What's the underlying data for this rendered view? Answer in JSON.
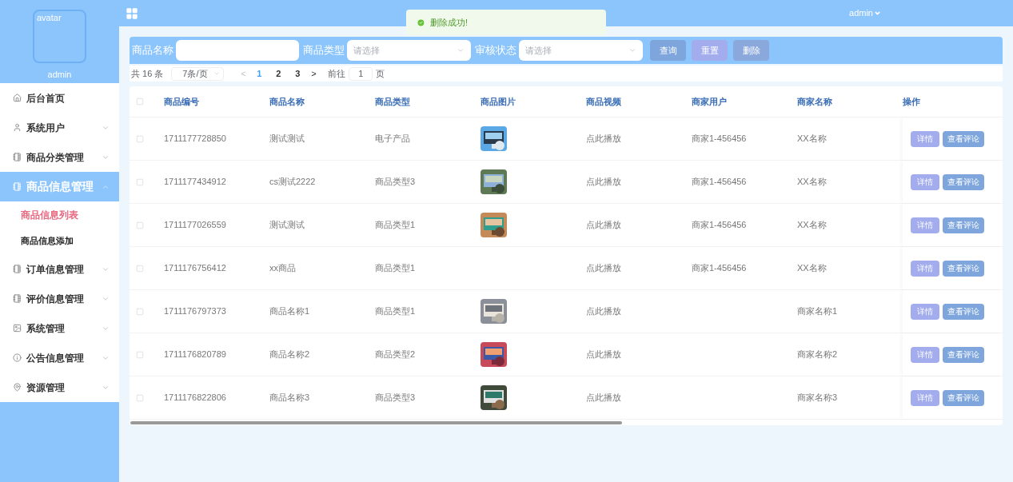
{
  "sidebar": {
    "avatar_alt": "avatar",
    "username": "admin",
    "items": [
      {
        "label": "后台首页",
        "kind": "link",
        "selected": false
      },
      {
        "label": "系统用户",
        "kind": "group",
        "expanded": false,
        "selected": false
      },
      {
        "label": "商品分类管理",
        "kind": "group",
        "expanded": false,
        "selected": false
      },
      {
        "label": "商品信息管理",
        "kind": "group",
        "expanded": true,
        "selected": true,
        "children": [
          {
            "label": "商品信息列表",
            "selected": true
          },
          {
            "label": "商品信息添加",
            "selected": false
          }
        ]
      },
      {
        "label": "订单信息管理",
        "kind": "group",
        "expanded": false,
        "selected": false
      },
      {
        "label": "评价信息管理",
        "kind": "group",
        "expanded": false,
        "selected": false
      },
      {
        "label": "系统管理",
        "kind": "group",
        "expanded": false,
        "selected": false
      },
      {
        "label": "公告信息管理",
        "kind": "group",
        "expanded": false,
        "selected": false
      },
      {
        "label": "资源管理",
        "kind": "group",
        "expanded": false,
        "selected": false
      }
    ]
  },
  "header": {
    "user_menu": "admin"
  },
  "toast": {
    "message": "删除成功!"
  },
  "search": {
    "fields": [
      {
        "label": "商品名称",
        "kind": "input"
      },
      {
        "label": "商品类型",
        "kind": "select",
        "placeholder": "请选择"
      },
      {
        "label": "审核状态",
        "kind": "select",
        "placeholder": "请选择"
      }
    ],
    "buttons": [
      "查询",
      "重置",
      "删除"
    ]
  },
  "pagination": {
    "total": "共 16 条",
    "page_size": "7条/页",
    "prev": "<",
    "pages": [
      {
        "label": "1",
        "selected": true
      },
      {
        "label": "2",
        "selected": false
      },
      {
        "label": "3",
        "selected": false
      }
    ],
    "next": ">",
    "goto_label": "前往",
    "goto_value": "1",
    "goto_suffix": "页"
  },
  "table": {
    "select_all_checked": false,
    "columns": [
      "商品编号",
      "商品名称",
      "商品类型",
      "商品图片",
      "商品视频",
      "商家用户",
      "商家名称",
      "操作"
    ],
    "rows": [
      {
        "checked": false,
        "id": "1711177728850",
        "name": "测试测试",
        "type": "电子产品",
        "image": {
          "kind": "picture"
        },
        "video": "点此播放",
        "merchant_user": "商家1-456456",
        "merchant_name": "XX名称",
        "actions": [
          "详情",
          "查看评论"
        ]
      },
      {
        "checked": false,
        "id": "1711177434912",
        "name": "cs测试2222",
        "type": "商品类型3",
        "image": {
          "kind": "picture"
        },
        "video": "点此播放",
        "merchant_user": "商家1-456456",
        "merchant_name": "XX名称",
        "actions": [
          "详情",
          "查看评论"
        ]
      },
      {
        "checked": false,
        "id": "1711177026559",
        "name": "测试测试",
        "type": "商品类型1",
        "image": {
          "kind": "picture"
        },
        "video": "点此播放",
        "merchant_user": "商家1-456456",
        "merchant_name": "XX名称",
        "actions": [
          "详情",
          "查看评论"
        ]
      },
      {
        "checked": false,
        "id": "1711176756412",
        "name": "xx商品",
        "type": "商品类型1",
        "video": "点此播放",
        "merchant_user": "商家1-456456",
        "merchant_name": "XX名称",
        "actions": [
          "详情",
          "查看评论"
        ]
      },
      {
        "checked": false,
        "id": "1711176797373",
        "name": "商品名称1",
        "type": "商品类型1",
        "image": {
          "kind": "picture"
        },
        "video": "点此播放",
        "merchant_name": "商家名称1",
        "actions": [
          "详情",
          "查看评论"
        ]
      },
      {
        "checked": false,
        "id": "1711176820789",
        "name": "商品名称2",
        "type": "商品类型2",
        "image": {
          "kind": "picture"
        },
        "video": "点此播放",
        "merchant_name": "商家名称2",
        "actions": [
          "详情",
          "查看评论"
        ]
      },
      {
        "checked": false,
        "id": "1711176822806",
        "name": "商品名称3",
        "type": "商品类型3",
        "image": {
          "kind": "picture"
        },
        "video": "点此播放",
        "merchant_name": "商家名称3",
        "actions": [
          "详情",
          "查看评论"
        ]
      }
    ]
  }
}
